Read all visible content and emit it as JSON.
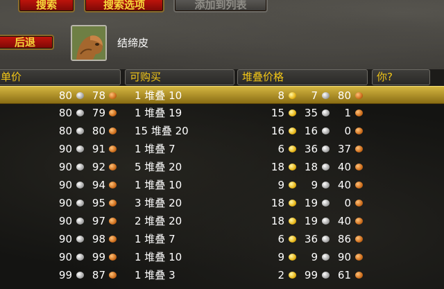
{
  "toolbar": {
    "search_label": "搜索",
    "search_options_label": "搜索选项",
    "add_to_list_label": "添加到列表",
    "back_label": "后退"
  },
  "item": {
    "name": "结缔皮",
    "icon": "leather-icon"
  },
  "columns": {
    "unit_price": "单价",
    "available": "可购买",
    "stack_price": "堆叠价格",
    "you": "你?"
  },
  "rows": [
    {
      "u1": "80",
      "u2": "78",
      "avail": "1 堆叠 10",
      "s1": "8",
      "s2": "7",
      "s3": "80",
      "selected": true
    },
    {
      "u1": "80",
      "u2": "79",
      "avail": "1 堆叠 19",
      "s1": "15",
      "s2": "35",
      "s3": "1"
    },
    {
      "u1": "80",
      "u2": "80",
      "avail": "15 堆叠 20",
      "s1": "16",
      "s2": "16",
      "s3": "0"
    },
    {
      "u1": "90",
      "u2": "91",
      "avail": "1 堆叠 7",
      "s1": "6",
      "s2": "36",
      "s3": "37"
    },
    {
      "u1": "90",
      "u2": "92",
      "avail": "5 堆叠 20",
      "s1": "18",
      "s2": "18",
      "s3": "40"
    },
    {
      "u1": "90",
      "u2": "94",
      "avail": "1 堆叠 10",
      "s1": "9",
      "s2": "9",
      "s3": "40"
    },
    {
      "u1": "90",
      "u2": "95",
      "avail": "3 堆叠 20",
      "s1": "18",
      "s2": "19",
      "s3": "0"
    },
    {
      "u1": "90",
      "u2": "97",
      "avail": "2 堆叠 20",
      "s1": "18",
      "s2": "19",
      "s3": "40"
    },
    {
      "u1": "90",
      "u2": "98",
      "avail": "1 堆叠 7",
      "s1": "6",
      "s2": "36",
      "s3": "86"
    },
    {
      "u1": "90",
      "u2": "99",
      "avail": "1 堆叠 10",
      "s1": "9",
      "s2": "9",
      "s3": "90"
    },
    {
      "u1": "99",
      "u2": "87",
      "avail": "1 堆叠 3",
      "s1": "2",
      "s2": "99",
      "s3": "61"
    }
  ]
}
